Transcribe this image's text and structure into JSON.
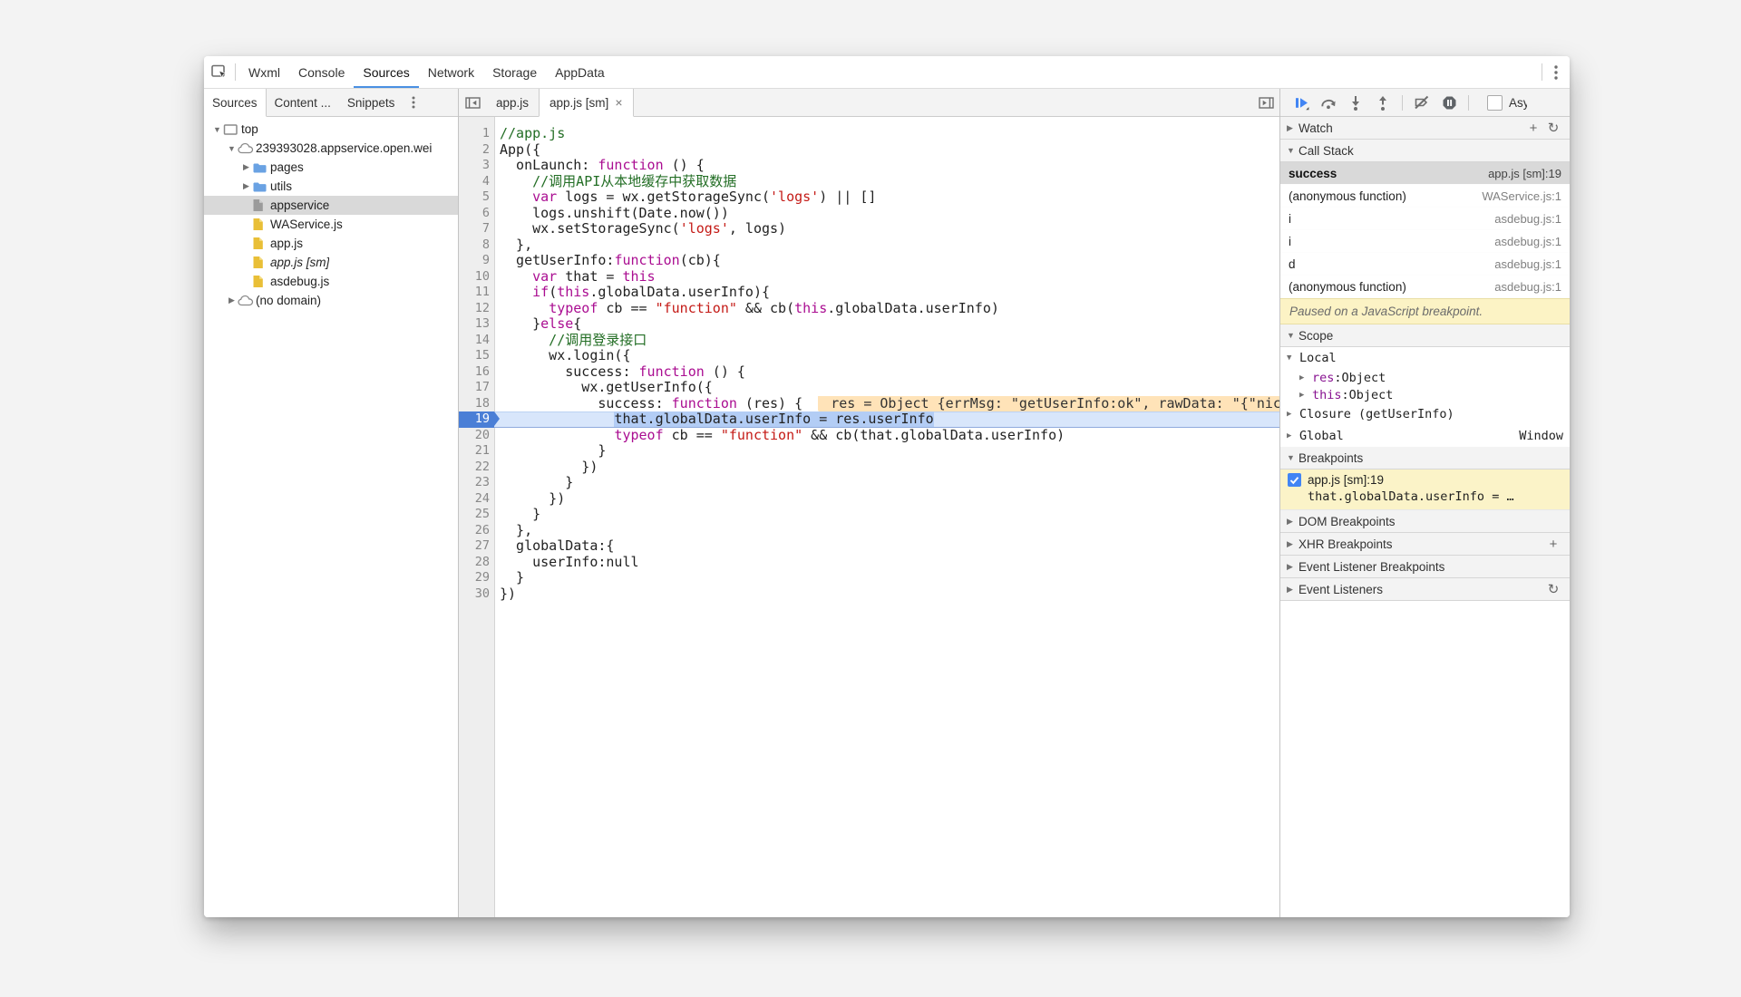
{
  "colors": {
    "accent": "#4a90e2",
    "exec_badge": "#4b7fd6",
    "paused_banner_bg": "#fcf3c5",
    "breakpoint_entry_bg": "#fbf3c8",
    "keyword": "#aa0d91",
    "string": "#c41a16",
    "comment": "#236e25"
  },
  "main_toolbar": {
    "tabs": [
      {
        "label": "Wxml"
      },
      {
        "label": "Console"
      },
      {
        "label": "Sources",
        "active": true
      },
      {
        "label": "Network"
      },
      {
        "label": "Storage"
      },
      {
        "label": "AppData"
      }
    ]
  },
  "navigator": {
    "tabs": [
      {
        "label": "Sources",
        "active": true
      },
      {
        "label": "Content ..."
      },
      {
        "label": "Snippets"
      }
    ],
    "tree": [
      {
        "depth": 0,
        "arrow": "down",
        "icon": "frame",
        "label": "top"
      },
      {
        "depth": 1,
        "arrow": "down",
        "icon": "cloud",
        "label": "239393028.appservice.open.wei"
      },
      {
        "depth": 2,
        "arrow": "right",
        "icon": "folder",
        "label": "pages"
      },
      {
        "depth": 2,
        "arrow": "right",
        "icon": "folder",
        "label": "utils"
      },
      {
        "depth": 2,
        "arrow": "none",
        "icon": "file-gray",
        "label": "appservice",
        "selected": true
      },
      {
        "depth": 2,
        "arrow": "none",
        "icon": "file-yellow",
        "label": "WAService.js"
      },
      {
        "depth": 2,
        "arrow": "none",
        "icon": "file-yellow",
        "label": "app.js"
      },
      {
        "depth": 2,
        "arrow": "none",
        "icon": "file-yellow",
        "label": "app.js [sm]",
        "italic": true
      },
      {
        "depth": 2,
        "arrow": "none",
        "icon": "file-yellow",
        "label": "asdebug.js"
      },
      {
        "depth": 1,
        "arrow": "right",
        "icon": "cloud",
        "label": "(no domain)"
      }
    ]
  },
  "editor": {
    "tabs": [
      {
        "label": "app.js"
      },
      {
        "label": "app.js [sm]",
        "active": true,
        "closable": true
      }
    ],
    "paused_line": 19,
    "inline_widget": " res = Object {errMsg: \"getUserInfo:ok\", rawData: \"{\"nick",
    "lines": [
      {
        "n": 1,
        "seg": [
          [
            "c",
            "//app.js"
          ]
        ]
      },
      {
        "n": 2,
        "seg": [
          [
            "p",
            "App({"
          ]
        ]
      },
      {
        "n": 3,
        "seg": [
          [
            "p",
            "  onLaunch: "
          ],
          [
            "k",
            "function"
          ],
          [
            "p",
            " () {"
          ]
        ]
      },
      {
        "n": 4,
        "seg": [
          [
            "c",
            "    //调用API从本地缓存中获取数据"
          ]
        ]
      },
      {
        "n": 5,
        "seg": [
          [
            "p",
            "    "
          ],
          [
            "k",
            "var"
          ],
          [
            "p",
            " logs = wx.getStorageSync("
          ],
          [
            "s",
            "'logs'"
          ],
          [
            "p",
            ") || []"
          ]
        ]
      },
      {
        "n": 6,
        "seg": [
          [
            "p",
            "    logs.unshift(Date.now())"
          ]
        ]
      },
      {
        "n": 7,
        "seg": [
          [
            "p",
            "    wx.setStorageSync("
          ],
          [
            "s",
            "'logs'"
          ],
          [
            "p",
            ", logs)"
          ]
        ]
      },
      {
        "n": 8,
        "seg": [
          [
            "p",
            "  },"
          ]
        ]
      },
      {
        "n": 9,
        "seg": [
          [
            "p",
            "  getUserInfo:"
          ],
          [
            "k",
            "function"
          ],
          [
            "p",
            "(cb){"
          ]
        ]
      },
      {
        "n": 10,
        "seg": [
          [
            "p",
            "    "
          ],
          [
            "k",
            "var"
          ],
          [
            "p",
            " that = "
          ],
          [
            "k",
            "this"
          ]
        ]
      },
      {
        "n": 11,
        "seg": [
          [
            "p",
            "    "
          ],
          [
            "k",
            "if"
          ],
          [
            "p",
            "("
          ],
          [
            "k",
            "this"
          ],
          [
            "p",
            ".globalData.userInfo){"
          ]
        ]
      },
      {
        "n": 12,
        "seg": [
          [
            "p",
            "      "
          ],
          [
            "k",
            "typeof"
          ],
          [
            "p",
            " cb == "
          ],
          [
            "s",
            "\"function\""
          ],
          [
            "p",
            " && cb("
          ],
          [
            "k",
            "this"
          ],
          [
            "p",
            ".globalData.userInfo)"
          ]
        ]
      },
      {
        "n": 13,
        "seg": [
          [
            "p",
            "    }"
          ],
          [
            "k",
            "else"
          ],
          [
            "p",
            "{"
          ]
        ]
      },
      {
        "n": 14,
        "seg": [
          [
            "c",
            "      //调用登录接口"
          ]
        ]
      },
      {
        "n": 15,
        "seg": [
          [
            "p",
            "      wx.login({"
          ]
        ]
      },
      {
        "n": 16,
        "seg": [
          [
            "p",
            "        success: "
          ],
          [
            "k",
            "function"
          ],
          [
            "p",
            " () {"
          ]
        ]
      },
      {
        "n": 17,
        "seg": [
          [
            "p",
            "          wx.getUserInfo({"
          ]
        ]
      },
      {
        "n": 18,
        "seg": [
          [
            "p",
            "            success: "
          ],
          [
            "k",
            "function"
          ],
          [
            "p",
            " (res) { "
          ]
        ],
        "widget": true
      },
      {
        "n": 19,
        "seg": [
          [
            "p",
            "              "
          ],
          [
            "sel",
            "that.globalData.userInfo = res.userInfo"
          ]
        ],
        "exec": true
      },
      {
        "n": 20,
        "seg": [
          [
            "p",
            "              "
          ],
          [
            "k",
            "typeof"
          ],
          [
            "p",
            " cb == "
          ],
          [
            "s",
            "\"function\""
          ],
          [
            "p",
            " && cb(that.globalData.userInfo)"
          ]
        ]
      },
      {
        "n": 21,
        "seg": [
          [
            "p",
            "            }"
          ]
        ]
      },
      {
        "n": 22,
        "seg": [
          [
            "p",
            "          })"
          ]
        ]
      },
      {
        "n": 23,
        "seg": [
          [
            "p",
            "        }"
          ]
        ]
      },
      {
        "n": 24,
        "seg": [
          [
            "p",
            "      })"
          ]
        ]
      },
      {
        "n": 25,
        "seg": [
          [
            "p",
            "    }"
          ]
        ]
      },
      {
        "n": 26,
        "seg": [
          [
            "p",
            "  },"
          ]
        ]
      },
      {
        "n": 27,
        "seg": [
          [
            "p",
            "  globalData:{"
          ]
        ]
      },
      {
        "n": 28,
        "seg": [
          [
            "p",
            "    userInfo:null"
          ]
        ]
      },
      {
        "n": 29,
        "seg": [
          [
            "p",
            "  }"
          ]
        ]
      },
      {
        "n": 30,
        "seg": [
          [
            "p",
            "})"
          ]
        ]
      }
    ]
  },
  "debugger_toolbar": {
    "buttons": [
      "resume",
      "step-over",
      "step-into",
      "step-out",
      "sep",
      "deactivate-breakpoints",
      "pause-on-exceptions",
      "sep"
    ],
    "async_label": "Async",
    "async_checked": false
  },
  "watch": {
    "label": "Watch"
  },
  "call_stack": {
    "label": "Call Stack",
    "frames": [
      {
        "fn": "success",
        "loc": "app.js [sm]:19",
        "active": true
      },
      {
        "fn": "(anonymous function)",
        "loc": "WAService.js:1"
      },
      {
        "fn": "i",
        "loc": "asdebug.js:1"
      },
      {
        "fn": "i",
        "loc": "asdebug.js:1"
      },
      {
        "fn": "d",
        "loc": "asdebug.js:1"
      },
      {
        "fn": "(anonymous function)",
        "loc": "asdebug.js:1"
      }
    ]
  },
  "paused_message": "Paused on a JavaScript breakpoint.",
  "scope": {
    "label": "Scope",
    "items": [
      {
        "kind": "group",
        "arrow": "down",
        "label": "Local"
      },
      {
        "kind": "prop",
        "arrow": "right",
        "key": "res",
        "sep": ": ",
        "value": "Object"
      },
      {
        "kind": "prop",
        "arrow": "right",
        "key": "this",
        "sep": ": ",
        "value": "Object"
      },
      {
        "kind": "group",
        "arrow": "right",
        "label": "Closure (getUserInfo)"
      },
      {
        "kind": "group",
        "arrow": "right",
        "label": "Global",
        "right": "Window"
      }
    ]
  },
  "breakpoints": {
    "label": "Breakpoints",
    "entries": [
      {
        "checked": true,
        "location": "app.js [sm]:19",
        "code": "that.globalData.userInfo = …"
      }
    ]
  },
  "more_sections": [
    {
      "label": "DOM Breakpoints"
    },
    {
      "label": "XHR Breakpoints",
      "action": "add"
    },
    {
      "label": "Event Listener Breakpoints"
    },
    {
      "label": "Event Listeners",
      "action": "refresh"
    }
  ]
}
